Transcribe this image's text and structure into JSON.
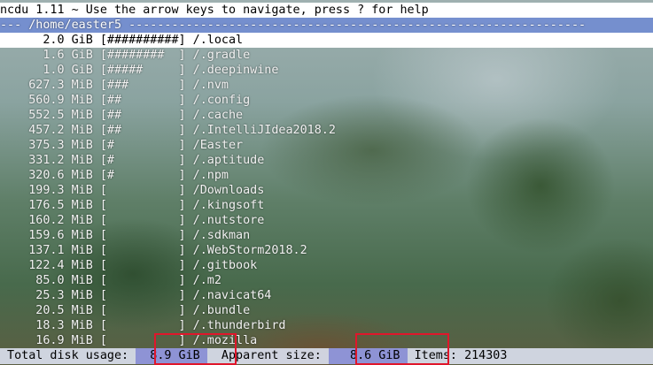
{
  "header": {
    "title_line": "ncdu 1.11 ~ Use the arrow keys to navigate, press ? for help",
    "path_line": "--- /home/easter5 ----------------------------------------------------------------"
  },
  "rows": [
    {
      "size": "2.0 GiB",
      "bar": "##########",
      "name": "/.local",
      "selected": true
    },
    {
      "size": "1.6 GiB",
      "bar": "########",
      "name": "/.gradle"
    },
    {
      "size": "1.0 GiB",
      "bar": "#####",
      "name": "/.deepinwine"
    },
    {
      "size": "627.3 MiB",
      "bar": "###",
      "name": "/.nvm"
    },
    {
      "size": "560.9 MiB",
      "bar": "##",
      "name": "/.config"
    },
    {
      "size": "552.5 MiB",
      "bar": "##",
      "name": "/.cache"
    },
    {
      "size": "457.2 MiB",
      "bar": "##",
      "name": "/.IntelliJIdea2018.2"
    },
    {
      "size": "375.3 MiB",
      "bar": "#",
      "name": "/Easter"
    },
    {
      "size": "331.2 MiB",
      "bar": "#",
      "name": "/.aptitude"
    },
    {
      "size": "320.6 MiB",
      "bar": "#",
      "name": "/.npm"
    },
    {
      "size": "199.3 MiB",
      "bar": "",
      "name": "/Downloads"
    },
    {
      "size": "176.5 MiB",
      "bar": "",
      "name": "/.kingsoft"
    },
    {
      "size": "160.2 MiB",
      "bar": "",
      "name": "/.nutstore"
    },
    {
      "size": "159.6 MiB",
      "bar": "",
      "name": "/.sdkman"
    },
    {
      "size": "137.1 MiB",
      "bar": "",
      "name": "/.WebStorm2018.2"
    },
    {
      "size": "122.4 MiB",
      "bar": "",
      "name": "/.gitbook"
    },
    {
      "size": "85.0 MiB",
      "bar": "",
      "name": "/.m2"
    },
    {
      "size": "25.3 MiB",
      "bar": "",
      "name": "/.navicat64"
    },
    {
      "size": "20.5 MiB",
      "bar": "",
      "name": "/.bundle"
    },
    {
      "size": "18.3 MiB",
      "bar": "",
      "name": "/.thunderbird"
    },
    {
      "size": "16.9 MiB",
      "bar": "",
      "name": "/.mozilla"
    }
  ],
  "status": {
    "total_label": " Total disk usage: ",
    "total_value": "  8.9 GiB ",
    "apparent_label": "  Apparent size: ",
    "apparent_value": "   8.6 GiB ",
    "items_label": " Items: ",
    "items_value": "214303"
  },
  "colors": {
    "selection": "#ffffff",
    "path_bar": "#6c89d6",
    "highlight_box": "#e0162b"
  }
}
